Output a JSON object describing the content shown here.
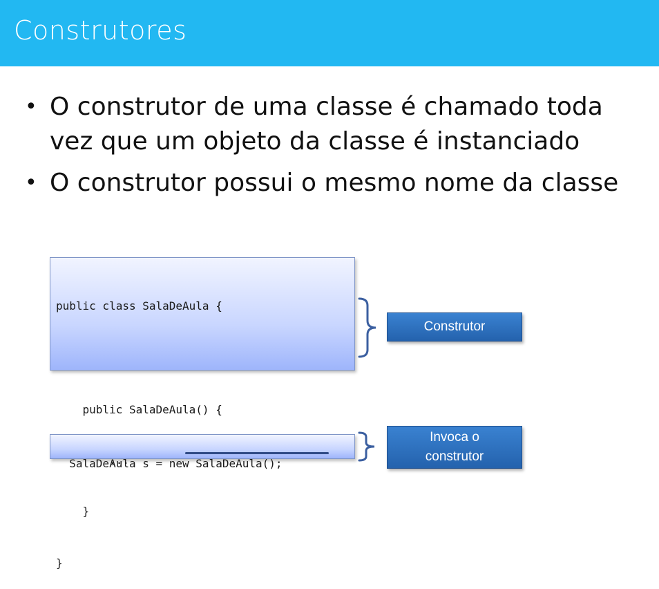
{
  "slide": {
    "title": "Construtores",
    "bullets": [
      "O construtor de uma classe é chamado toda vez que um objeto da classe é instanciado",
      "O construtor possui o mesmo nome da classe"
    ]
  },
  "code_block_1": {
    "lines": [
      "public class SalaDeAula {",
      "",
      "    public SalaDeAula() {",
      "        ...",
      "    }",
      "}"
    ]
  },
  "code_block_2": {
    "line": "SalaDeAula s = new SalaDeAula();"
  },
  "labels": {
    "construtor": "Construtor",
    "invoca_line1": "Invoca o",
    "invoca_line2": "construtor"
  },
  "colors": {
    "header": "#22b8f2",
    "label_button": "#2a6cbb",
    "brace": "#3b5fa0"
  }
}
